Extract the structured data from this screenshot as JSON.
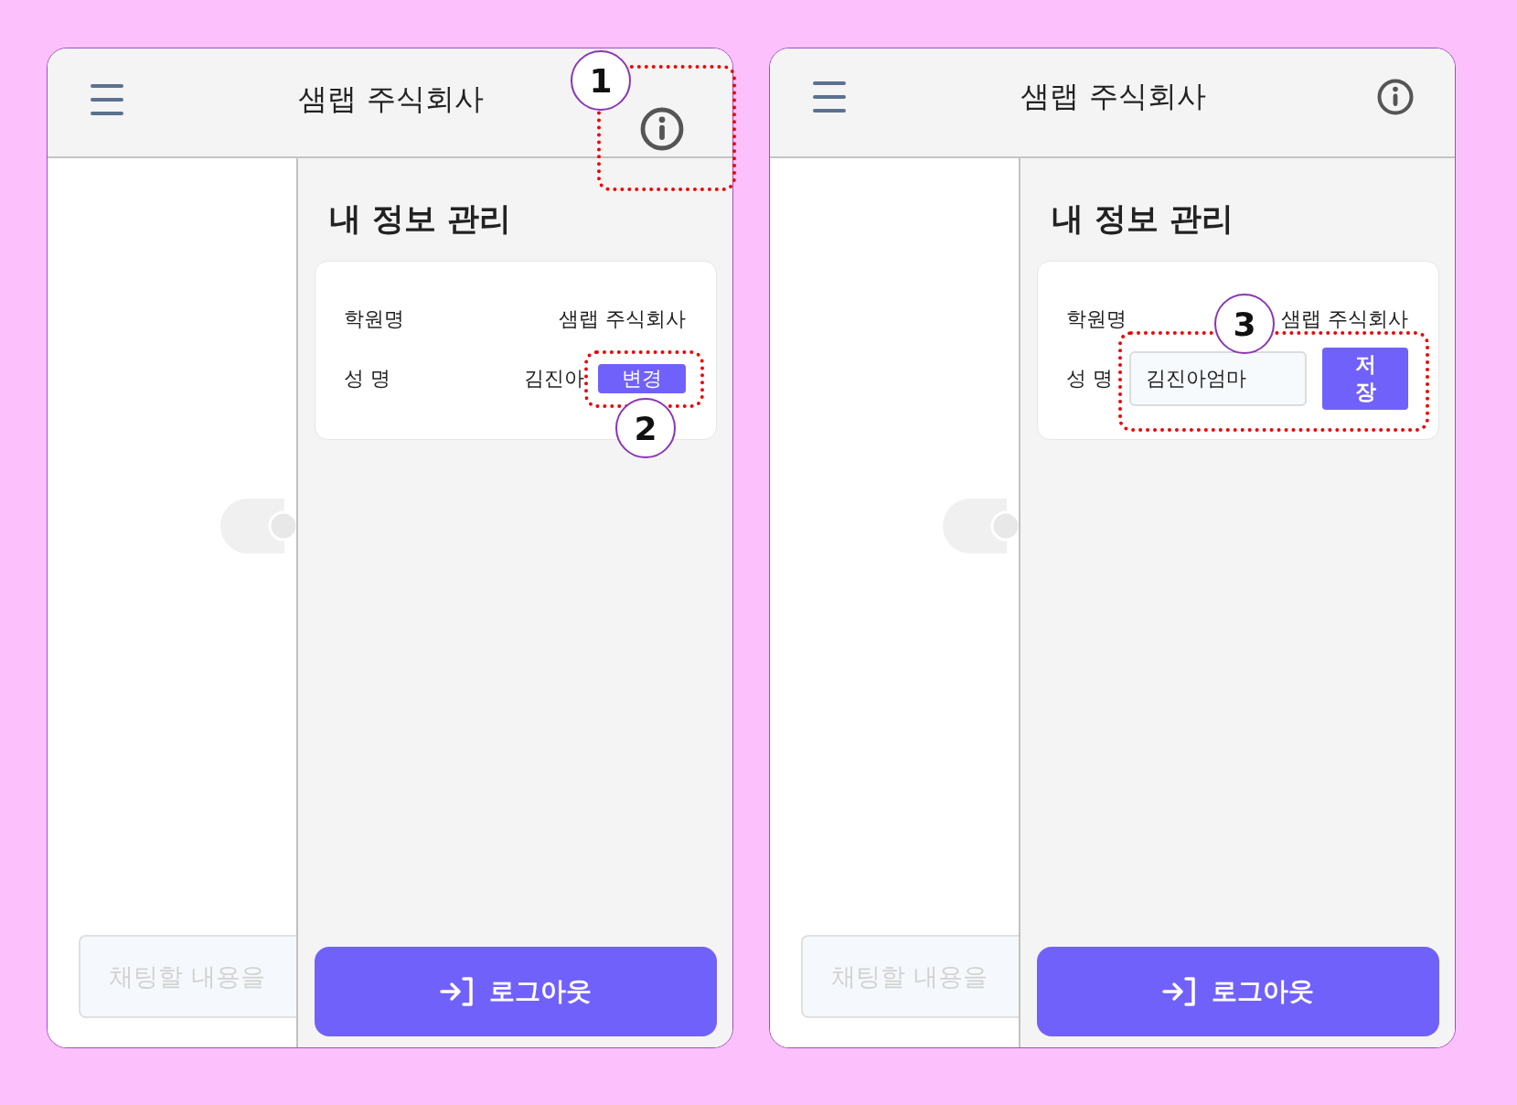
{
  "screens": [
    {
      "header": {
        "title": "샘랩 주식회사",
        "info_callout": "1"
      },
      "chat_input": {
        "placeholder": "채팅할 내용을"
      },
      "panel": {
        "heading": "내 정보 관리",
        "rows": [
          {
            "kind": "text",
            "label": "학원명",
            "value": "샘랩 주식회사"
          },
          {
            "kind": "editable",
            "label": "성 명",
            "value": "김진아",
            "button": "변경",
            "editing": false,
            "callout": "2"
          }
        ],
        "logout_button": "로그아웃"
      }
    },
    {
      "header": {
        "title": "샘랩 주식회사"
      },
      "chat_input": {
        "placeholder": "채팅할 내용을"
      },
      "panel": {
        "heading": "내 정보 관리",
        "rows": [
          {
            "kind": "text",
            "label": "학원명",
            "value": "샘랩 주식회사"
          },
          {
            "kind": "editable",
            "label": "성 명",
            "value": "김진아엄마",
            "button": "저장",
            "editing": true,
            "callout": "3"
          }
        ],
        "logout_button": "로그아웃"
      }
    }
  ]
}
